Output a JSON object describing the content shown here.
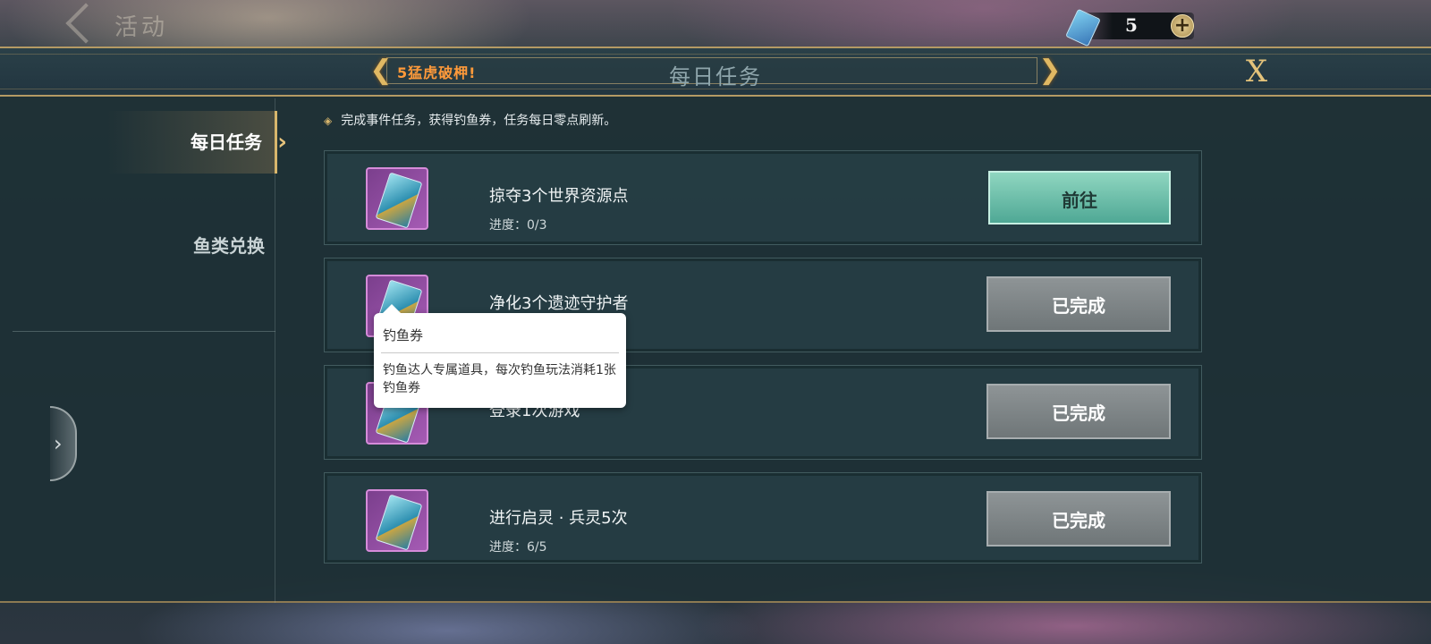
{
  "topbar": {
    "back_label": "活动",
    "currency_amount": "5",
    "currency_icon": "fishing-ticket-icon",
    "plus_label": "+"
  },
  "header": {
    "marquee_text": "5猛虎破柙!",
    "title": "每日任务",
    "close_label": "X"
  },
  "sidebar": {
    "tabs": [
      {
        "label": "每日任务",
        "active": true
      },
      {
        "label": "鱼类兑换",
        "active": false
      }
    ],
    "handle_label": "›"
  },
  "main": {
    "description": "完成事件任务，获得钓鱼券，任务每日零点刷新。",
    "tasks": [
      {
        "name": "掠夺3个世界资源点",
        "progress": "进度：0/3",
        "button": "前往",
        "state": "go"
      },
      {
        "name": "净化3个遗迹守护者",
        "progress": "",
        "button": "已完成",
        "state": "done"
      },
      {
        "name": "登录1次游戏",
        "progress": "",
        "button": "已完成",
        "state": "done"
      },
      {
        "name": "进行启灵 · 兵灵5次",
        "progress": "进度：6/5",
        "button": "已完成",
        "state": "done"
      }
    ]
  },
  "tooltip": {
    "title": "钓鱼券",
    "body": "钓鱼达人专属道具，每次钓鱼玩法消耗1张钓鱼券"
  },
  "colors": {
    "accent_gold": "#d8b66c",
    "go_button": "#6fc0aa",
    "done_button": "#7f8587",
    "marquee": "#ff9a3a"
  }
}
